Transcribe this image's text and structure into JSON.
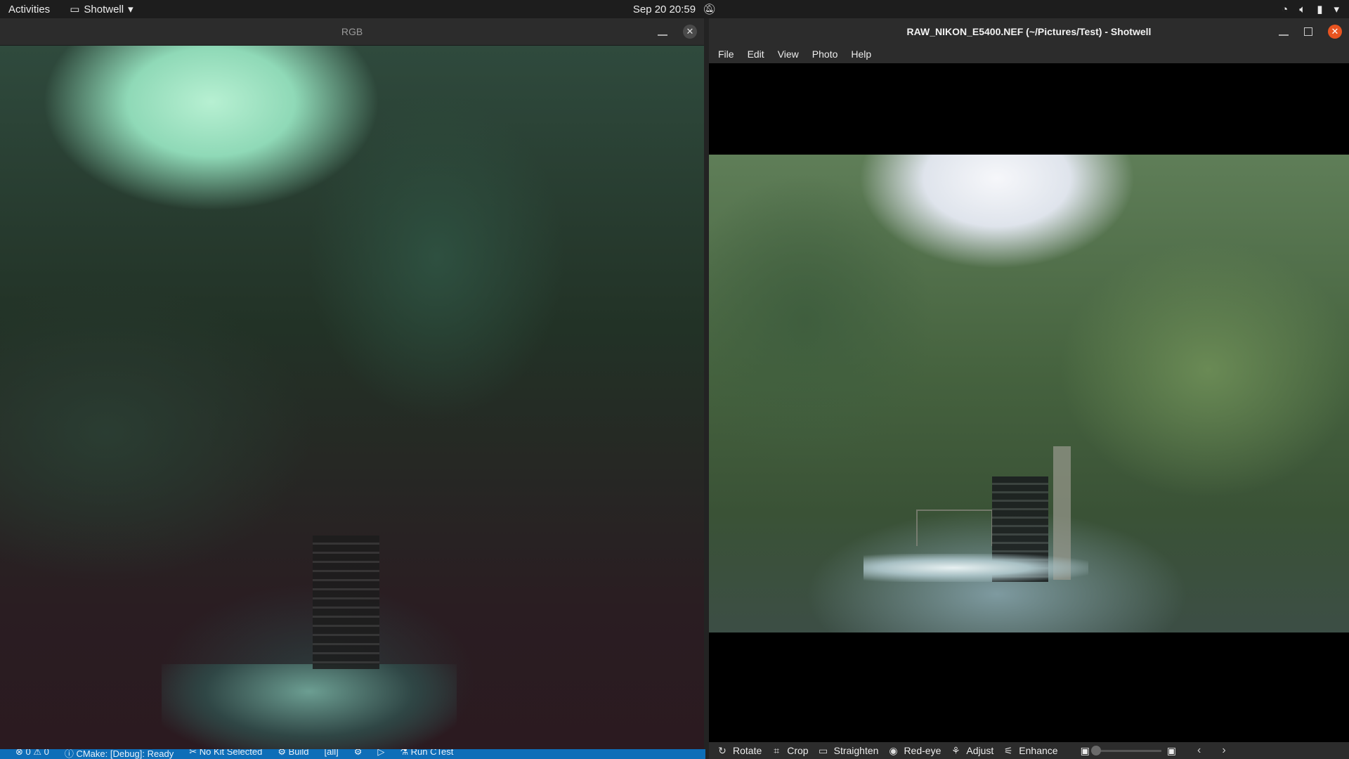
{
  "topbar": {
    "activities": "Activities",
    "app_name": "Shotwell",
    "clock": "Sep 20  20:59",
    "icons": [
      "wifi-icon",
      "volume-icon",
      "battery-icon",
      "system-menu-icon"
    ]
  },
  "rgb_window": {
    "title": "RGB",
    "controls": [
      "minimize-icon",
      "close-icon"
    ]
  },
  "statusbar": {
    "items": [
      "⊗ 0 ⚠ 0",
      "ⓘ CMake: [Debug]: Ready",
      "✂ No Kit Selected",
      "⚙ Build",
      "[all]",
      "⚙",
      "▷",
      "⚗ Run CTest"
    ]
  },
  "shotwell": {
    "title": "RAW_NIKON_E5400.NEF (~/Pictures/Test) - Shotwell",
    "menu": [
      "File",
      "Edit",
      "View",
      "Photo",
      "Help"
    ],
    "toolbar": {
      "rotate": "Rotate",
      "crop": "Crop",
      "straighten": "Straighten",
      "redeye": "Red-eye",
      "adjust": "Adjust",
      "enhance": "Enhance"
    },
    "zoom_level": 0,
    "accent": "#e95420",
    "statusbar_color": "#0e6eb8"
  }
}
